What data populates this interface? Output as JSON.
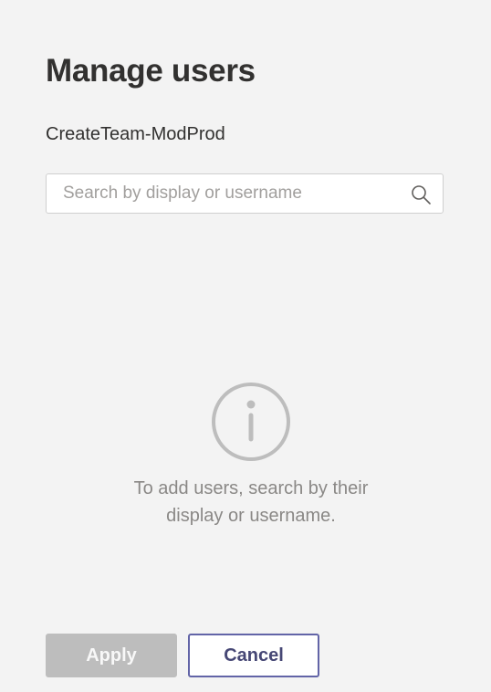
{
  "dialog": {
    "title": "Manage users",
    "subtitle": "CreateTeam-ModProd"
  },
  "search": {
    "value": "",
    "placeholder": "Search by display or username",
    "icon": "search-icon"
  },
  "empty_state": {
    "icon": "info-icon",
    "message": "To add users, search by their display or username."
  },
  "actions": {
    "apply_label": "Apply",
    "apply_disabled": true,
    "cancel_label": "Cancel"
  },
  "colors": {
    "background": "#f3f3f3",
    "accent": "#6264a7",
    "disabled_button": "#bdbdbd",
    "muted_text": "#8a8886"
  }
}
